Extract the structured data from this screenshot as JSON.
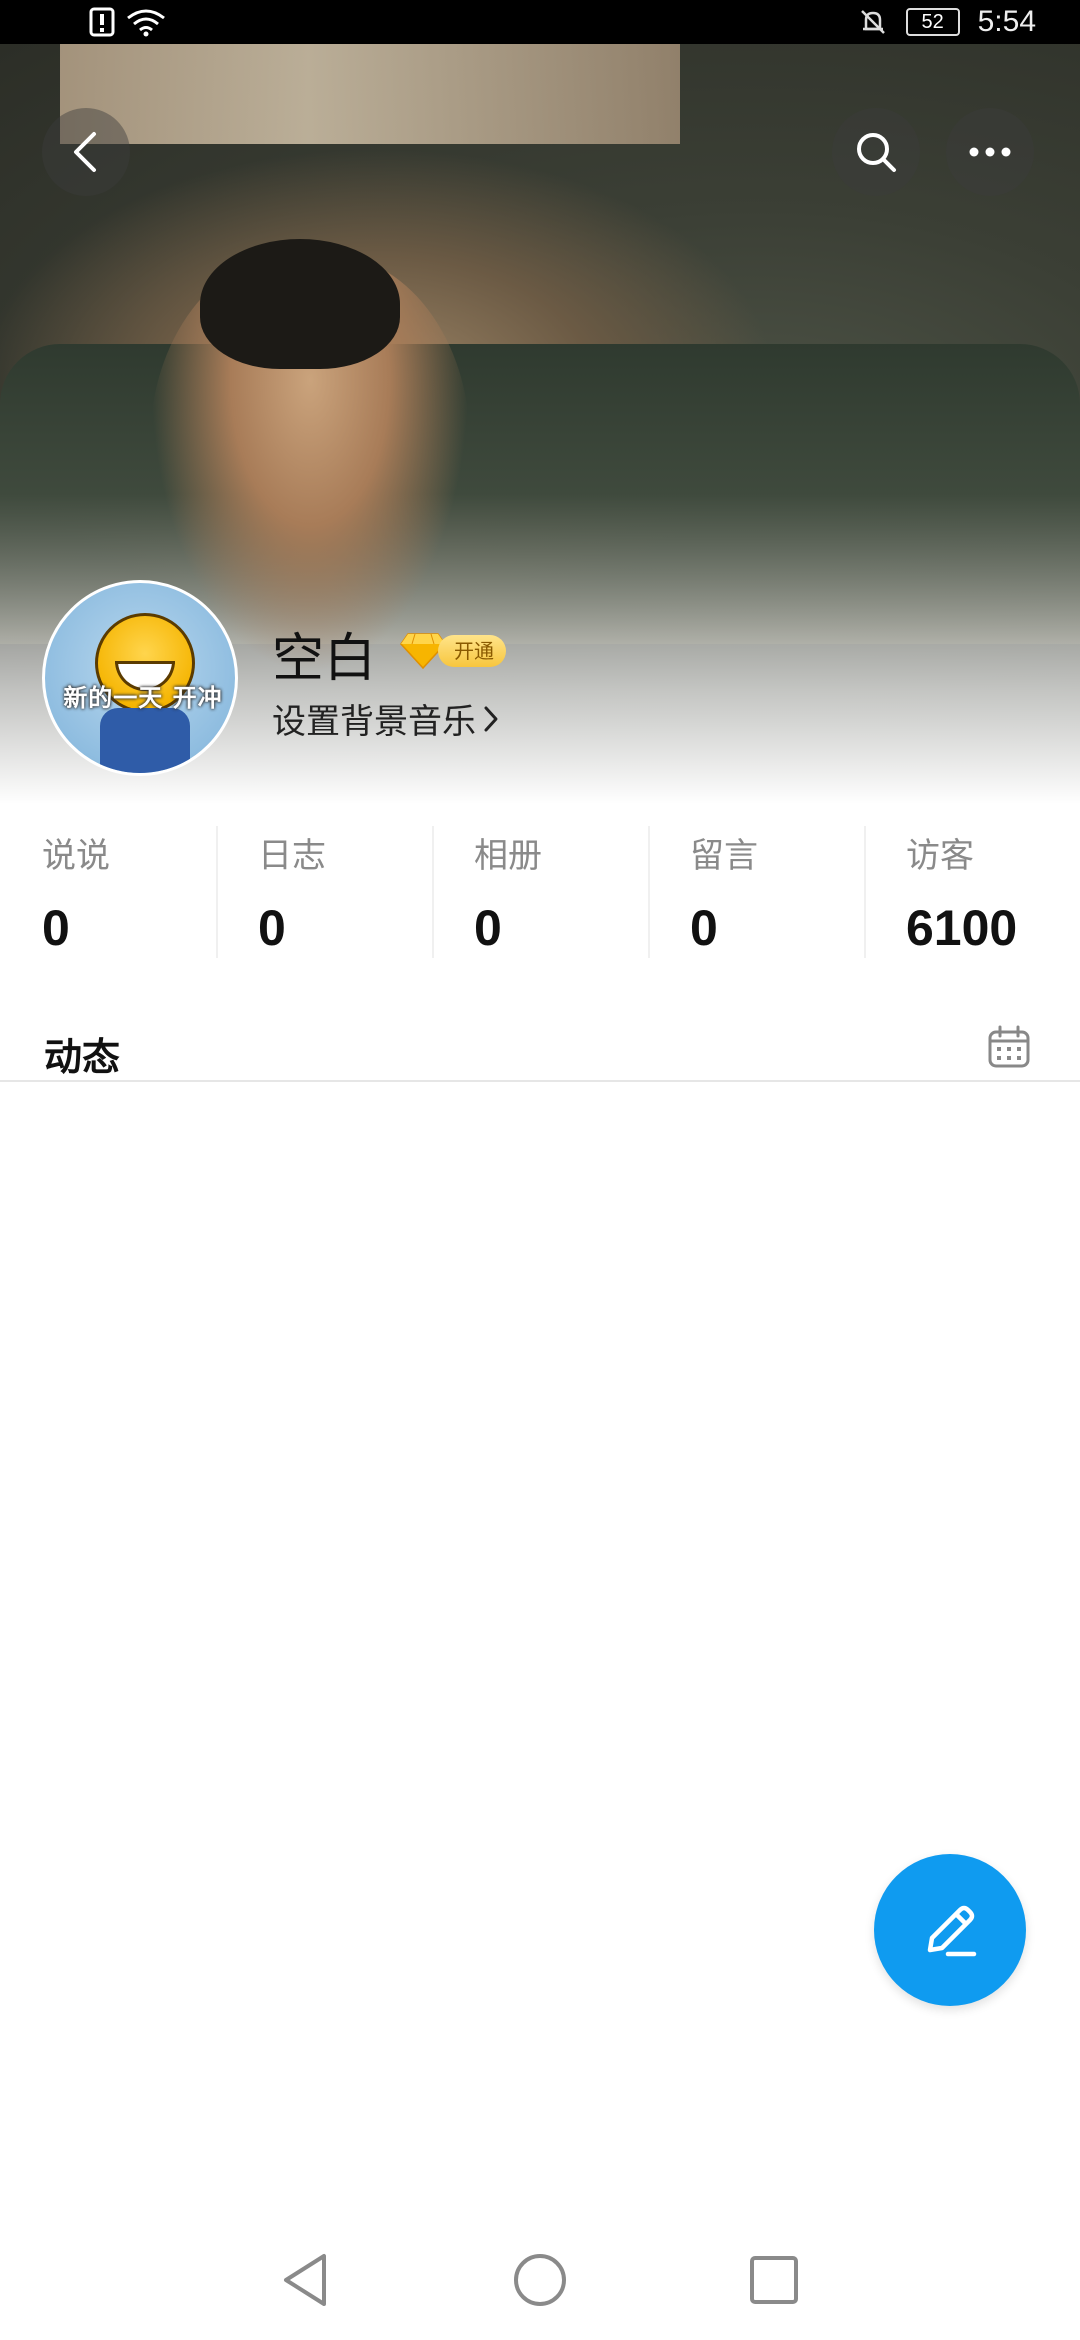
{
  "status_bar": {
    "time": "5:54",
    "battery": "52",
    "icons": [
      "alert-icon",
      "wifi-icon",
      "mute-bell-icon",
      "battery-icon"
    ]
  },
  "header": {
    "icons": [
      "back-icon",
      "search-icon",
      "more-icon"
    ]
  },
  "profile": {
    "avatar_caption": "新的一天 开冲",
    "username": "空白",
    "vip_label": "开通",
    "music_link": "设置背景音乐"
  },
  "stats": [
    {
      "label": "说说",
      "value": "0"
    },
    {
      "label": "日志",
      "value": "0"
    },
    {
      "label": "相册",
      "value": "0"
    },
    {
      "label": "留言",
      "value": "0"
    },
    {
      "label": "访客",
      "value": "6100"
    }
  ],
  "feed": {
    "title": "动态",
    "calendar_icon": "calendar-icon"
  },
  "fab": {
    "icon": "edit-icon"
  },
  "colors": {
    "accent": "#0f9bf0",
    "vip_gold": "#f7c63e"
  }
}
